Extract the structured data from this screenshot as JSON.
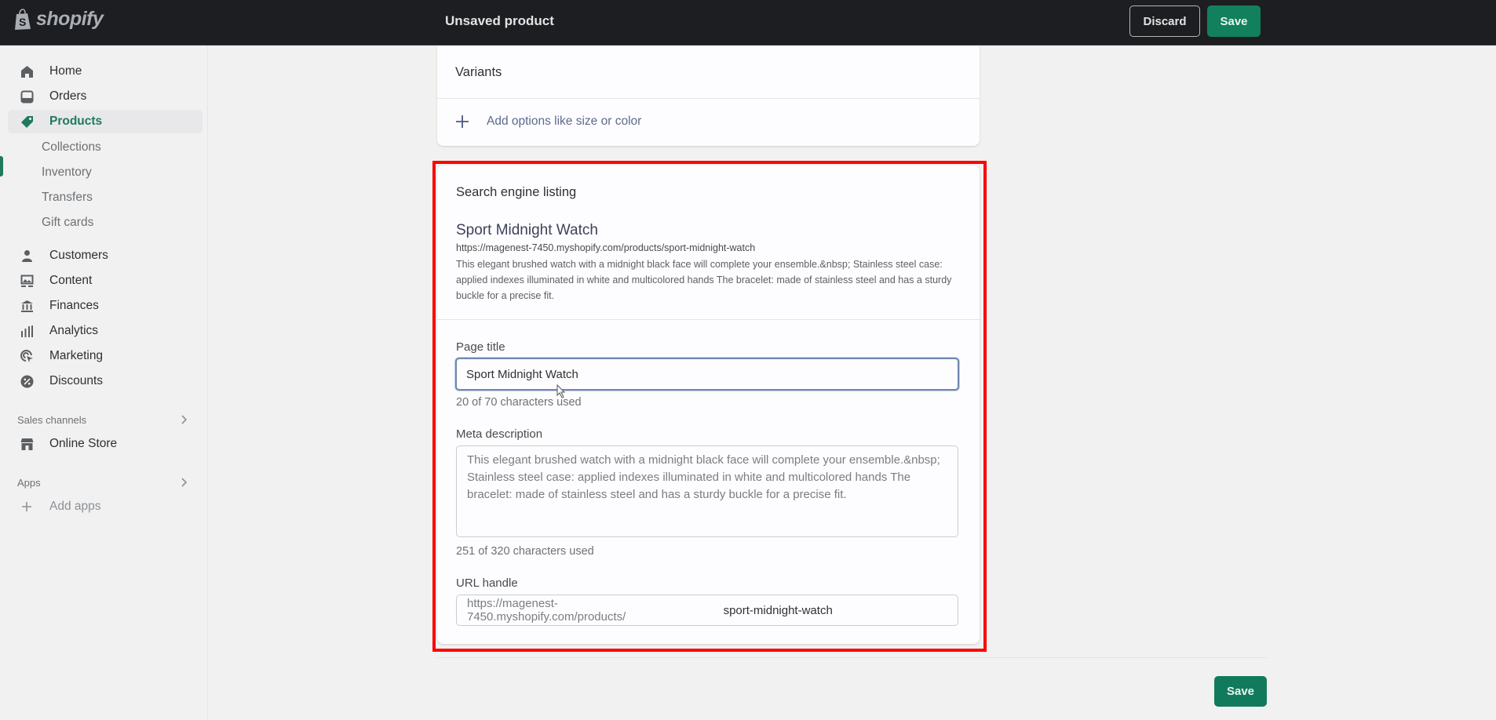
{
  "topbar": {
    "logo_text": "shopify",
    "page_title": "Unsaved product",
    "discard_label": "Discard",
    "save_label": "Save"
  },
  "sidebar": {
    "items": [
      {
        "label": "Home",
        "icon": "home-icon"
      },
      {
        "label": "Orders",
        "icon": "orders-icon"
      },
      {
        "label": "Products",
        "icon": "tag-icon",
        "active": true
      },
      {
        "label": "Customers",
        "icon": "person-icon"
      },
      {
        "label": "Content",
        "icon": "content-icon"
      },
      {
        "label": "Finances",
        "icon": "bank-icon"
      },
      {
        "label": "Analytics",
        "icon": "bar-chart-icon"
      },
      {
        "label": "Marketing",
        "icon": "target-icon"
      },
      {
        "label": "Discounts",
        "icon": "discount-icon"
      }
    ],
    "product_subitems": [
      "Collections",
      "Inventory",
      "Transfers",
      "Gift cards"
    ],
    "sales_channels": {
      "label": "Sales channels",
      "items": [
        {
          "label": "Online Store",
          "icon": "store-icon"
        }
      ]
    },
    "apps": {
      "label": "Apps",
      "add_label": "Add apps"
    }
  },
  "variants": {
    "title": "Variants",
    "add_options_label": "Add options like size or color"
  },
  "seo": {
    "title": "Search engine listing",
    "preview": {
      "title": "Sport Midnight Watch",
      "url": "https://magenest-7450.myshopify.com/products/sport-midnight-watch",
      "description": "This elegant brushed watch with a midnight black face will complete your ensemble.&nbsp; Stainless steel case: applied indexes illuminated in white and multicolored hands The bracelet: made of stainless steel and has a sturdy buckle for a precise fit."
    },
    "page_title": {
      "label": "Page title",
      "value": "Sport Midnight Watch",
      "help": "20 of 70 characters used"
    },
    "meta_description": {
      "label": "Meta description",
      "value": "This elegant brushed watch with a midnight black face will complete your ensemble.&nbsp; Stainless steel case: applied indexes illuminated in white and multicolored hands The bracelet: made of stainless steel and has a sturdy buckle for a precise fit.",
      "help": "251 of 320 characters used"
    },
    "url_handle": {
      "label": "URL handle",
      "prefix": "https://magenest-7450.myshopify.com/products/",
      "value": "sport-midnight-watch"
    }
  },
  "footer": {
    "save_label": "Save"
  },
  "colors": {
    "brand_green": "#12805c",
    "highlight_red": "#ff0000",
    "topbar_bg": "#1d1e21"
  }
}
